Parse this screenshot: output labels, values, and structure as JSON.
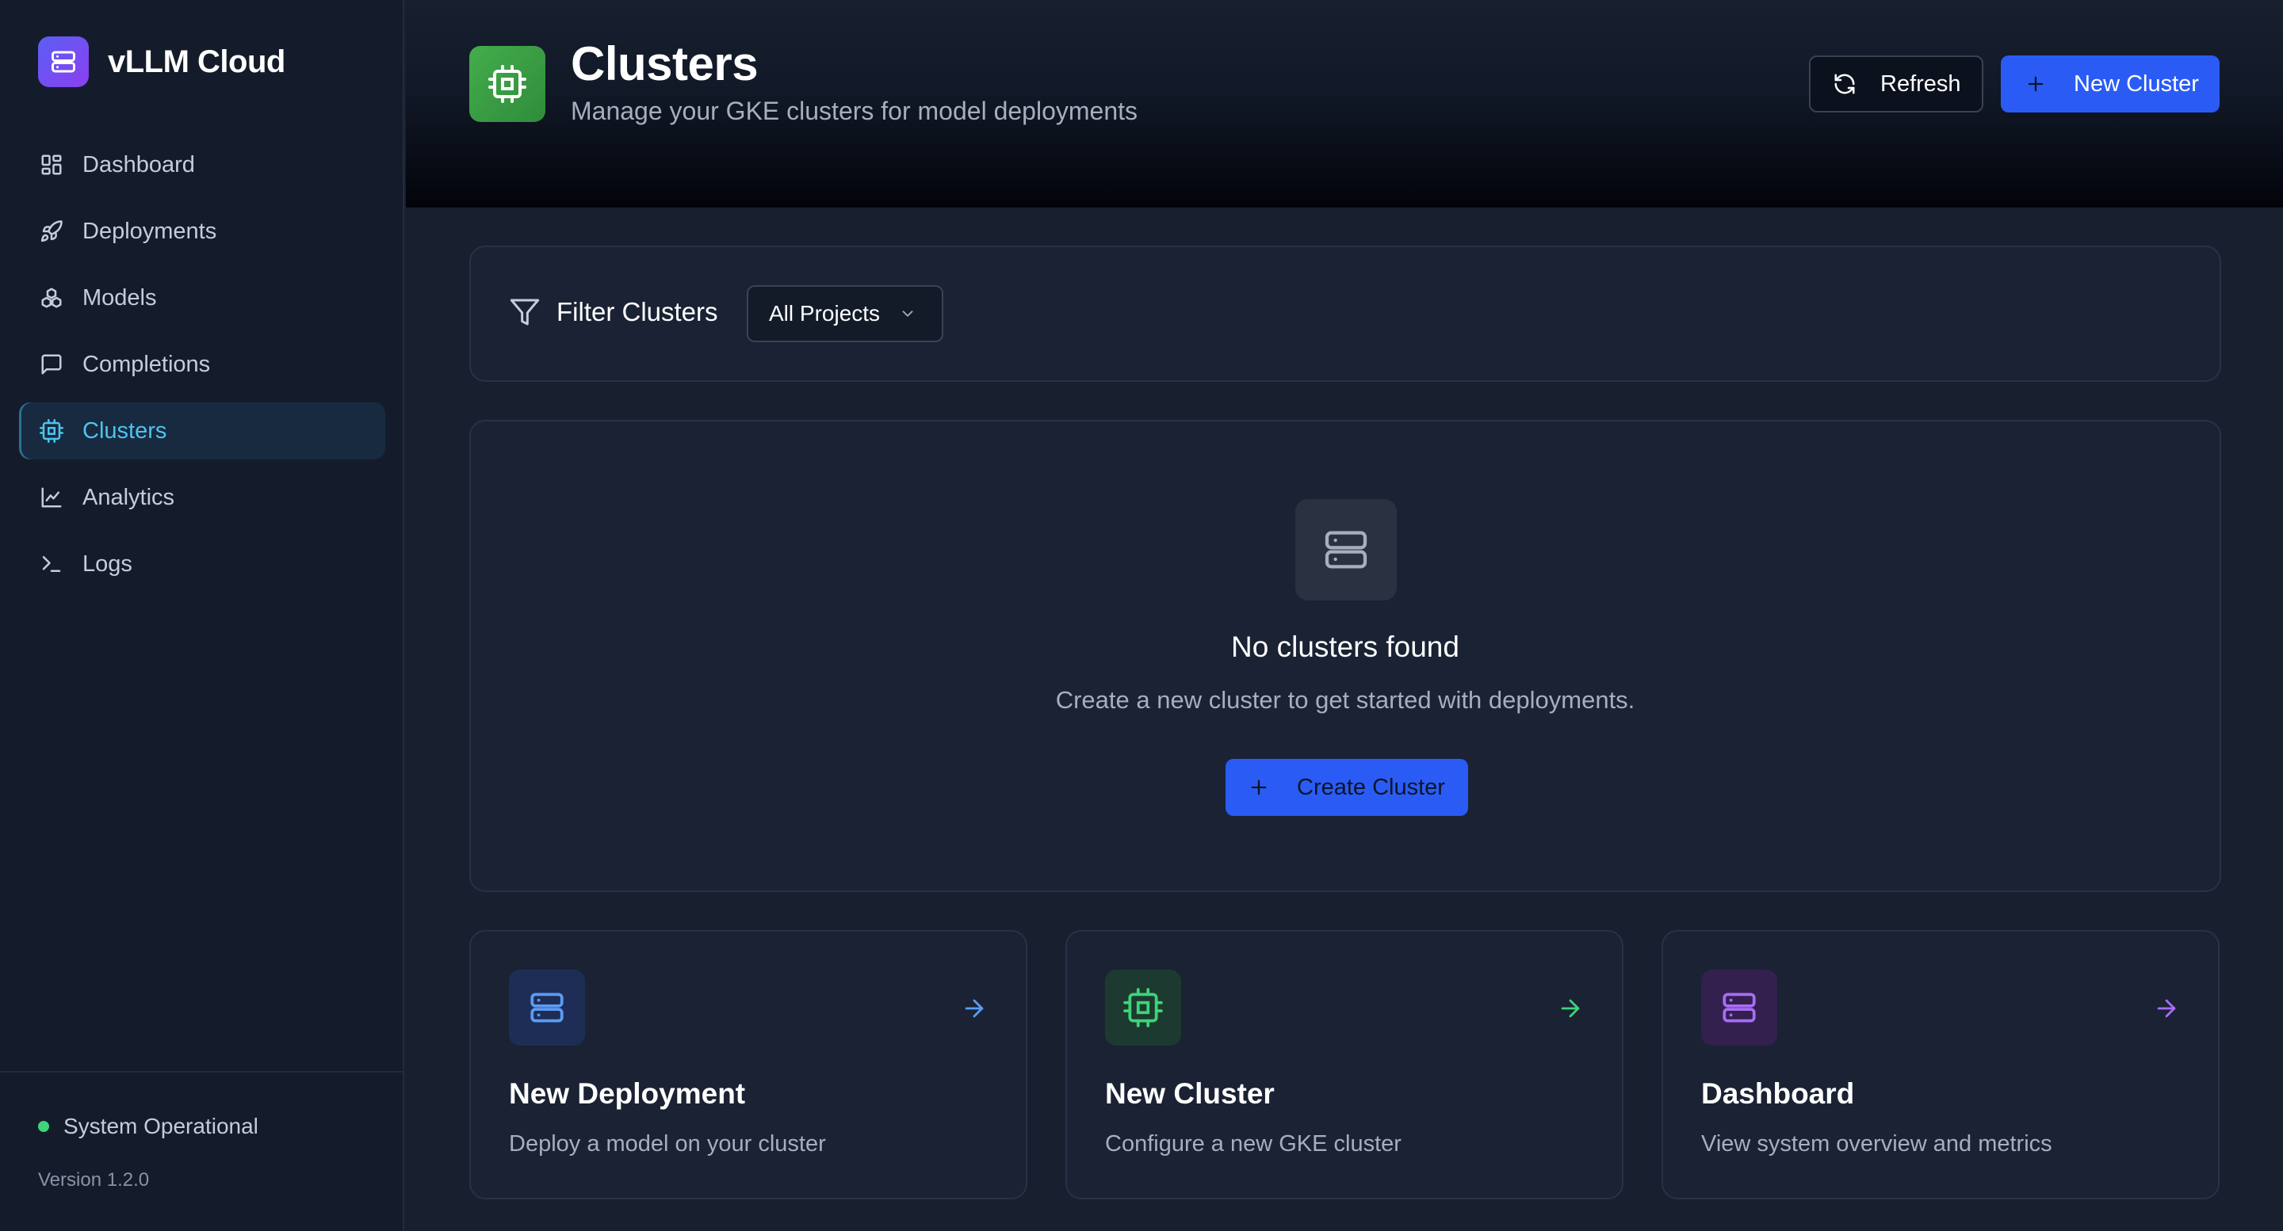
{
  "brand": {
    "name": "vLLM Cloud"
  },
  "sidebar": {
    "items": [
      {
        "label": "Dashboard",
        "icon": "dashboard-icon"
      },
      {
        "label": "Deployments",
        "icon": "rocket-icon"
      },
      {
        "label": "Models",
        "icon": "models-icon"
      },
      {
        "label": "Completions",
        "icon": "chat-icon"
      },
      {
        "label": "Clusters",
        "icon": "cpu-icon",
        "active": true
      },
      {
        "label": "Analytics",
        "icon": "chart-icon"
      },
      {
        "label": "Logs",
        "icon": "terminal-icon"
      }
    ],
    "status": "System Operational",
    "version": "Version 1.2.0"
  },
  "header": {
    "title": "Clusters",
    "subtitle": "Manage your GKE clusters for model deployments",
    "refresh_label": "Refresh",
    "new_cluster_label": "New Cluster"
  },
  "filter": {
    "label": "Filter Clusters",
    "selected": "All Projects"
  },
  "empty_state": {
    "title": "No clusters found",
    "text": "Create a new cluster to get started with deployments.",
    "button_label": "Create Cluster"
  },
  "quick_actions": [
    {
      "title": "New Deployment",
      "description": "Deploy a model on your cluster",
      "icon": "server-icon",
      "color": "#5b9bf5"
    },
    {
      "title": "New Cluster",
      "description": "Configure a new GKE cluster",
      "icon": "cpu-icon",
      "color": "#3fd37a"
    },
    {
      "title": "Dashboard",
      "description": "View system overview and metrics",
      "icon": "server-icon",
      "color": "#a86cf5"
    }
  ],
  "colors": {
    "accent": "#2a5cf5",
    "active_nav": "#4ec3ee",
    "success": "#3fd37a"
  }
}
